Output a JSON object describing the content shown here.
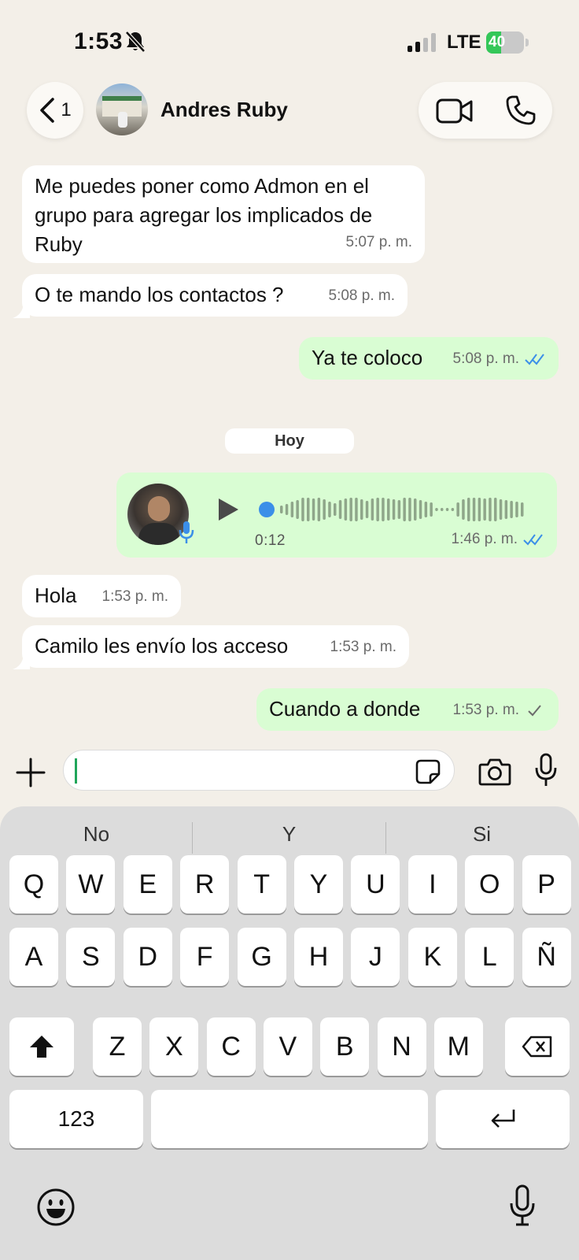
{
  "status_bar": {
    "time": "1:53",
    "network": "LTE",
    "battery_percent": "40",
    "battery_level": 0.4,
    "silent_mode_icon": "bell-slash-icon",
    "colors": {
      "battery_fill": "#34c759"
    }
  },
  "header": {
    "back_count": "1",
    "contact_name": "Andres Ruby",
    "icons": [
      "chevron-left-icon",
      "video-call-icon",
      "phone-call-icon"
    ]
  },
  "messages": [
    {
      "direction": "in",
      "text": "Me puedes poner como Admon en el grupo para agregar los implicados de Ruby",
      "time": "5:07 p. m."
    },
    {
      "direction": "in",
      "text": "O te mando los contactos ?",
      "time": "5:08 p. m."
    },
    {
      "direction": "out",
      "text": "Ya te coloco",
      "time": "5:08 p. m.",
      "status": "read"
    },
    {
      "direction": "out",
      "type": "voice",
      "duration": "0:12",
      "time": "1:46 p. m.",
      "status": "read"
    },
    {
      "direction": "in",
      "text": "Hola",
      "time": "1:53 p. m."
    },
    {
      "direction": "in",
      "text": "Camilo les envío los acceso",
      "time": "1:53 p. m."
    },
    {
      "direction": "out",
      "text": "Cuando a donde",
      "time": "1:53 p. m.",
      "status": "sent"
    }
  ],
  "day_separator": "Hoy",
  "composer": {
    "value": "",
    "icons": [
      "plus-icon",
      "sticker-icon",
      "camera-icon",
      "microphone-icon"
    ]
  },
  "keyboard": {
    "suggestions": [
      "No",
      "Y",
      "Si"
    ],
    "row1": [
      "Q",
      "W",
      "E",
      "R",
      "T",
      "Y",
      "U",
      "I",
      "O",
      "P"
    ],
    "row2": [
      "A",
      "S",
      "D",
      "F",
      "G",
      "H",
      "J",
      "K",
      "L",
      "Ñ"
    ],
    "row3": [
      "Z",
      "X",
      "C",
      "V",
      "B",
      "N",
      "M"
    ],
    "numbers_label": "123",
    "icons": [
      "shift-icon",
      "backspace-icon",
      "return-icon",
      "emoji-icon",
      "dictation-mic-icon"
    ]
  },
  "colors": {
    "background": "#f3efe8",
    "incoming_bubble": "#ffffff",
    "outgoing_bubble": "#d9fdd3",
    "read_tick": "#3b8fe8",
    "caret": "#20a55a"
  }
}
